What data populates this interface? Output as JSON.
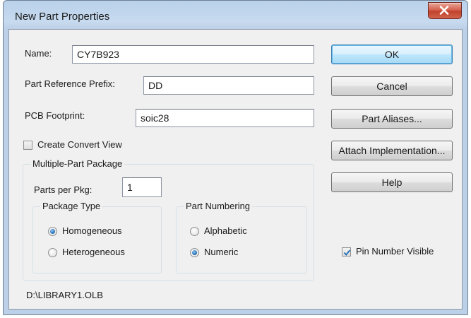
{
  "window": {
    "title": "New Part Properties",
    "close_glyph": "X"
  },
  "fields": {
    "name": {
      "label": "Name:",
      "value": "CY7B923"
    },
    "prefix": {
      "label": "Part Reference Prefix:",
      "value": "DD"
    },
    "footprint": {
      "label": "PCB Footprint:",
      "value": "soic28"
    }
  },
  "create_convert_view": {
    "label": "Create Convert View",
    "checked": false
  },
  "multi_part": {
    "title": "Multiple-Part Package",
    "parts_per_pkg_label": "Parts per Pkg:",
    "parts_per_pkg_value": "1",
    "package_type": {
      "title": "Package Type",
      "options": [
        {
          "label": "Homogeneous",
          "checked": true
        },
        {
          "label": "Heterogeneous",
          "checked": false
        }
      ]
    },
    "part_numbering": {
      "title": "Part Numbering",
      "options": [
        {
          "label": "Alphabetic",
          "checked": false
        },
        {
          "label": "Numeric",
          "checked": true
        }
      ]
    }
  },
  "buttons": {
    "ok": "OK",
    "cancel": "Cancel",
    "part_aliases": "Part Aliases...",
    "attach_impl": "Attach Implementation...",
    "help": "Help"
  },
  "pin_number_visible": {
    "label": "Pin Number Visible",
    "checked": true
  },
  "library_path": "D:\\LIBRARY1.OLB",
  "colors": {
    "accent": "#2b73b8",
    "close": "#c2422c"
  }
}
